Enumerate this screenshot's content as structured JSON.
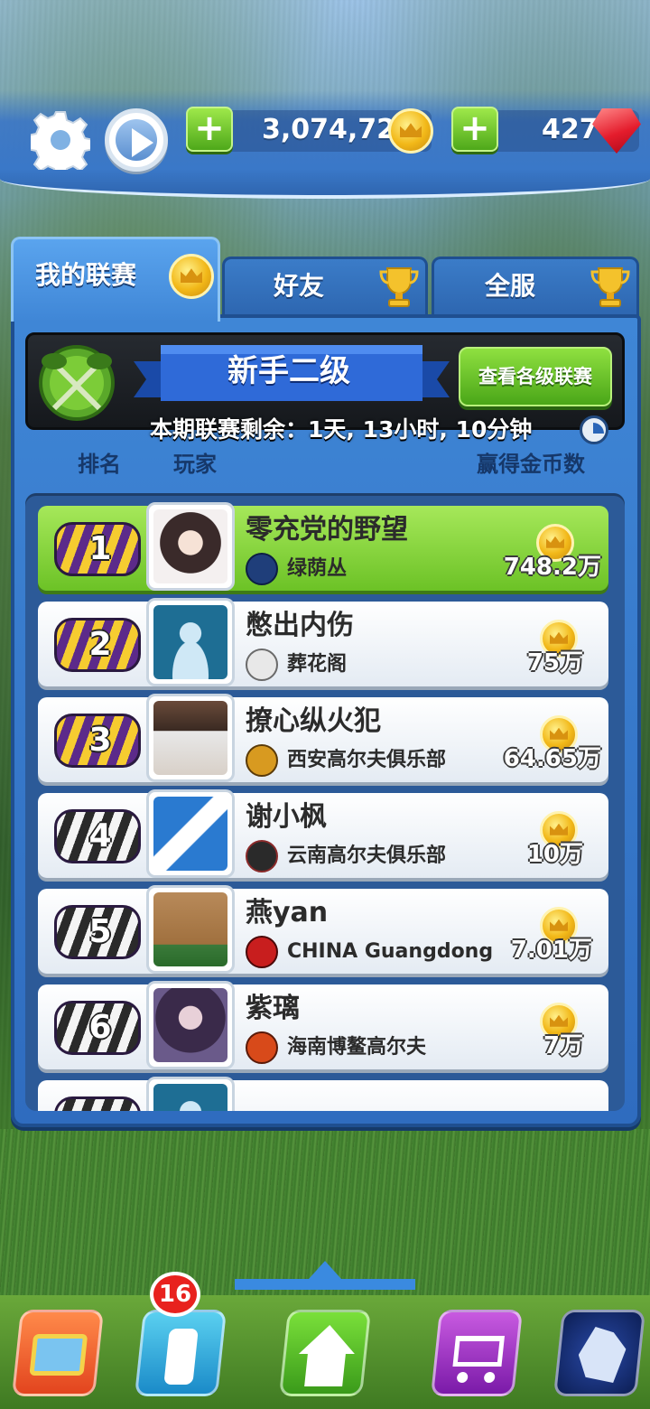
{
  "header": {
    "coins": "3,074,729",
    "gems": "427",
    "add_coins_label": "+",
    "add_gems_label": "+"
  },
  "tabs": [
    {
      "label": "我的联赛",
      "active": true
    },
    {
      "label": "好友",
      "active": false
    },
    {
      "label": "全服",
      "active": false
    }
  ],
  "league": {
    "name": "新手二级",
    "view_button": "查看各级联赛",
    "timer": "本期联赛剩余：1天, 13小时, 10分钟"
  },
  "columns": {
    "rank": "排名",
    "player": "玩家",
    "reward": "赢得金币数"
  },
  "leaderboard": [
    {
      "rank": "1",
      "name": "零充党的野望",
      "club": "绿荫丛",
      "reward": "748.2万"
    },
    {
      "rank": "2",
      "name": "憋出内伤",
      "club": "葬花阁",
      "reward": "75万"
    },
    {
      "rank": "3",
      "name": "撩心纵火犯",
      "club": "西安高尔夫俱乐部",
      "reward": "64.65万"
    },
    {
      "rank": "4",
      "name": "谢小枫",
      "club": "云南高尔夫俱乐部",
      "reward": "10万"
    },
    {
      "rank": "5",
      "name": "燕yan",
      "club": "CHINA Guangdong",
      "reward": "7.01万"
    },
    {
      "rank": "6",
      "name": "紫璃",
      "club": "海南博鳌高尔夫",
      "reward": "7万"
    }
  ],
  "bottom_nav": {
    "notification_count": "16",
    "items": [
      "tv-icon",
      "golf-bag-icon",
      "home-icon",
      "shop-cart-icon",
      "horse-emblem-icon"
    ]
  },
  "colors": {
    "accent_blue": "#3f86d6",
    "accent_green": "#6cc226",
    "gold": "#f2b818"
  }
}
